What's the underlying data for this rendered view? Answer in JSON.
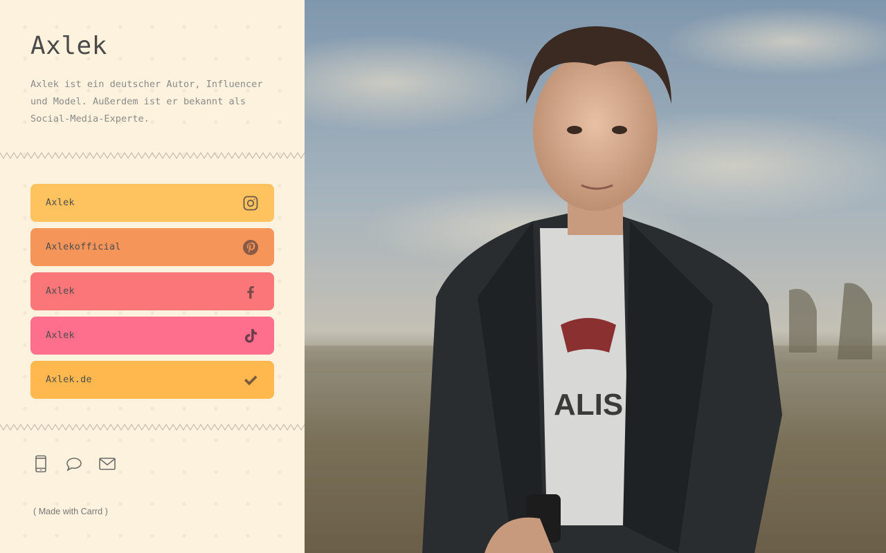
{
  "profile": {
    "name": "Axlek",
    "description": "Axlek ist ein deutscher Autor, Influencer und Model. Außerdem ist er bekannt als Social-Media-Experte."
  },
  "links": [
    {
      "label": "Axlek",
      "icon": "instagram-icon",
      "color": "#fec35f"
    },
    {
      "label": "Axlekofficial",
      "icon": "pinterest-icon",
      "color": "#f5955a"
    },
    {
      "label": "Axlek",
      "icon": "facebook-icon",
      "color": "#fb7679"
    },
    {
      "label": "Axlek",
      "icon": "tiktok-icon",
      "color": "#fe6f8d"
    },
    {
      "label": "Axlek.de",
      "icon": "checkmark-icon",
      "color": "#feb84e"
    }
  ],
  "contact": {
    "icons": [
      "phone-icon",
      "chat-icon",
      "mail-icon"
    ]
  },
  "footer": {
    "made_with": "( Made with Carrd )"
  },
  "colors": {
    "background": "#fdf2dd",
    "text": "#4a4a4a",
    "muted": "#8a8a8a",
    "icon": "#6b5a4a"
  }
}
